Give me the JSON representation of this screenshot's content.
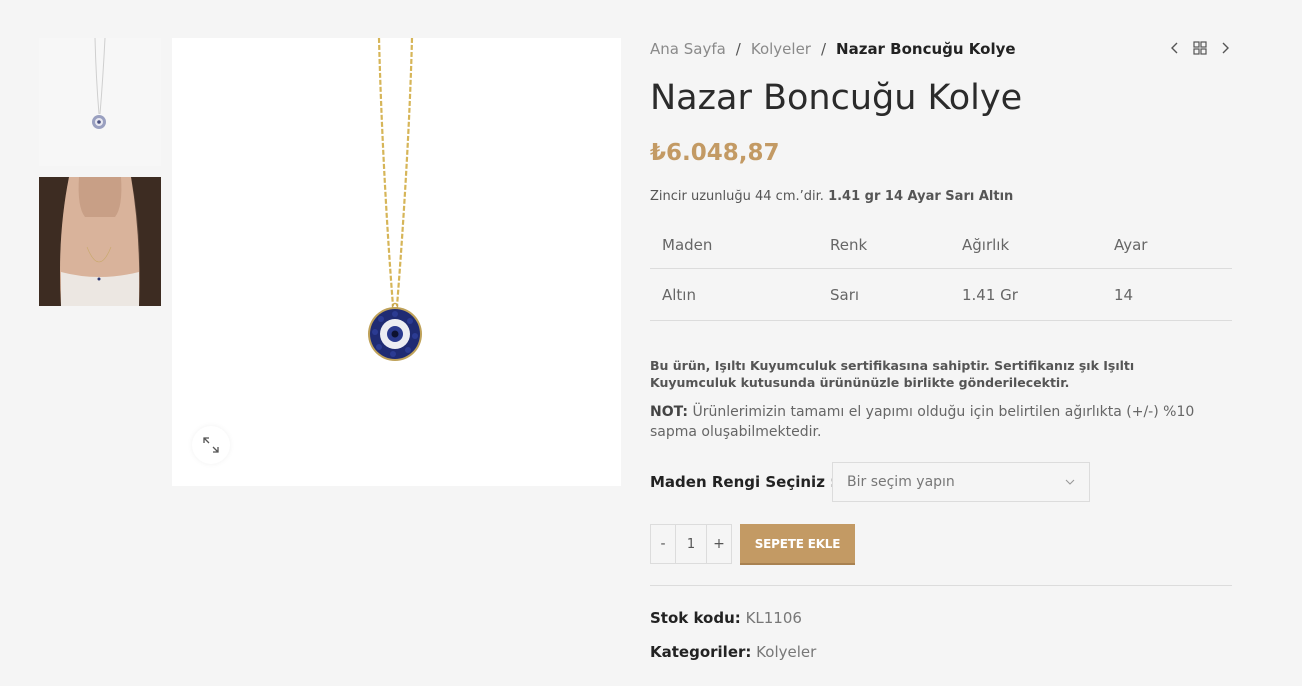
{
  "gallery": {
    "thumbnails": [
      {
        "alt": "necklace-product-thumb"
      },
      {
        "alt": "model-wearing-necklace-thumb"
      }
    ],
    "expand_icon": "expand-icon"
  },
  "breadcrumb": {
    "home": "Ana Sayfa",
    "category": "Kolyeler",
    "current": "Nazar Boncuğu Kolye",
    "separator": "/"
  },
  "product_nav": {
    "prev_icon": "chevron-left-icon",
    "grid_icon": "grid-icon",
    "next_icon": "chevron-right-icon"
  },
  "product": {
    "title": "Nazar Boncuğu Kolye",
    "price": "₺6.048,87",
    "short_desc_prefix": "Zincir uzunluğu 44 cm.’dir.",
    "short_desc_bold": "1.41 gr 14 Ayar Sarı Altın"
  },
  "specs": {
    "headers": [
      "Maden",
      "Renk",
      "Ağırlık",
      "Ayar"
    ],
    "row": [
      "Altın",
      "Sarı",
      "1.41 Gr",
      "14"
    ]
  },
  "certificate_text": "Bu ürün, Işıltı Kuyumculuk sertifikasına sahiptir. Sertifikanız şık Işıltı Kuyumculuk kutusunda ürününüzle birlikte gönderilecektir.",
  "note": {
    "label": "NOT:",
    "text": "Ürünlerimizin tamamı el yapımı olduğu için belirtilen ağırlıkta (+/-) %10 sapma oluşabilmektedir."
  },
  "variation": {
    "label": "Maden Rengi Seçiniz",
    "colon": ":",
    "selected": "Bir seçim yapın"
  },
  "cart": {
    "minus": "-",
    "quantity": "1",
    "plus": "+",
    "add_label": "SEPETE EKLE"
  },
  "meta": {
    "sku_label": "Stok kodu:",
    "sku_value": "KL1106",
    "category_label": "Kategoriler:",
    "category_value": "Kolyeler"
  },
  "colors": {
    "accent": "#c39a64",
    "background": "#f5f5f5",
    "chain_gold": "#d6b558",
    "bead_blue": "#22307a"
  }
}
